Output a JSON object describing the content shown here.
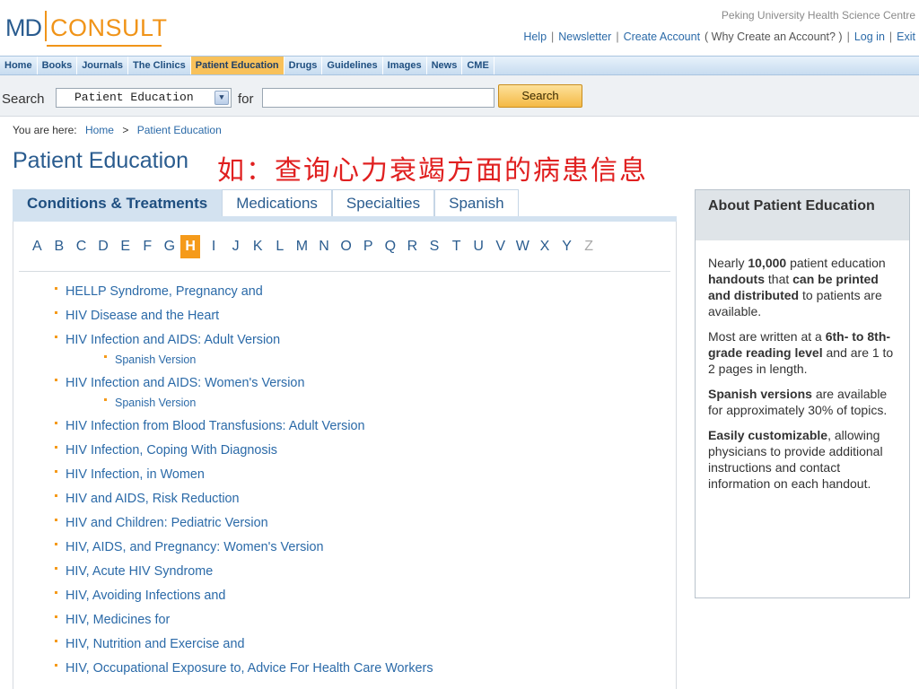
{
  "logo": {
    "md": "MD",
    "consult": "CONSULT"
  },
  "header": {
    "institution": "Peking University Health Science Centre",
    "links": [
      "Help",
      "Newsletter",
      "Create Account",
      "( Why Create an Account? )",
      "Log in",
      "Exit"
    ]
  },
  "nav": {
    "items": [
      "Home",
      "Books",
      "Journals",
      "The Clinics",
      "Patient Education",
      "Drugs",
      "Guidelines",
      "Images",
      "News",
      "CME"
    ],
    "active": "Patient Education"
  },
  "search": {
    "label": "Search",
    "scope_value": "Patient Education",
    "for_label": "for",
    "query_value": "",
    "button_label": "Search"
  },
  "breadcrumb": {
    "prefix": "You are here:",
    "items": [
      "Home",
      "Patient Education"
    ],
    "separator": ">"
  },
  "page": {
    "title": "Patient Education",
    "annotation": "如：查询心力衰竭方面的病患信息"
  },
  "tabs": {
    "items": [
      "Conditions & Treatments",
      "Medications",
      "Specialties",
      "Spanish"
    ],
    "active": "Conditions & Treatments"
  },
  "alphabet": {
    "letters": [
      "A",
      "B",
      "C",
      "D",
      "E",
      "F",
      "G",
      "H",
      "I",
      "J",
      "K",
      "L",
      "M",
      "N",
      "O",
      "P",
      "Q",
      "R",
      "S",
      "T",
      "U",
      "V",
      "W",
      "X",
      "Y",
      "Z"
    ],
    "active": "H",
    "disabled": [
      "Z"
    ]
  },
  "topics": [
    {
      "label": "HELLP Syndrome, Pregnancy and"
    },
    {
      "label": "HIV Disease and the Heart"
    },
    {
      "label": "HIV Infection and AIDS: Adult Version",
      "sub": "Spanish Version"
    },
    {
      "label": "HIV Infection and AIDS: Women's Version",
      "sub": "Spanish Version"
    },
    {
      "label": "HIV Infection from Blood Transfusions: Adult Version"
    },
    {
      "label": "HIV Infection, Coping With Diagnosis"
    },
    {
      "label": "HIV Infection, in Women"
    },
    {
      "label": "HIV and AIDS, Risk Reduction"
    },
    {
      "label": "HIV and Children: Pediatric Version"
    },
    {
      "label": "HIV, AIDS, and Pregnancy: Women's Version"
    },
    {
      "label": "HIV, Acute HIV Syndrome"
    },
    {
      "label": "HIV, Avoiding Infections and"
    },
    {
      "label": "HIV, Medicines for"
    },
    {
      "label": "HIV, Nutrition and Exercise and"
    },
    {
      "label": "HIV, Occupational Exposure to, Advice For Health Care Workers"
    }
  ],
  "sidebar": {
    "title": "About Patient Education",
    "p1": {
      "a": "Nearly ",
      "b1": "10,000",
      "c": " patient education ",
      "b2": "handouts",
      "d": " that ",
      "b3": "can be printed and distributed",
      "e": " to patients are available."
    },
    "p2": {
      "a": "Most are written at a ",
      "b1": "6th- to 8th-grade reading level",
      "c": " and are 1 to 2 pages in length."
    },
    "p3": {
      "b1": "Spanish versions",
      "a": " are available for approximately 30% of topics."
    },
    "p4": {
      "b1": "Easily customizable",
      "a": ", allowing physicians to provide additional instructions and contact information on each handout."
    }
  }
}
